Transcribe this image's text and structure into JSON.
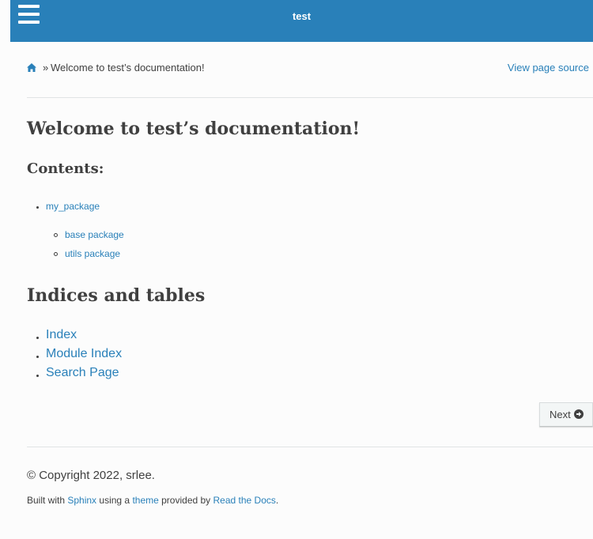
{
  "header": {
    "title": "test",
    "menu_icon": "hamburger-menu-icon",
    "color": "#2980b9"
  },
  "breadcrumbs": {
    "home_icon": "home-icon",
    "separator": "»",
    "current": "Welcome to test’s documentation!",
    "view_source": "View page source"
  },
  "main": {
    "title": "Welcome to test’s documentation!",
    "contents_caption": "Contents:",
    "toc": [
      {
        "label": "my_package",
        "children": [
          {
            "label": "base package"
          },
          {
            "label": "utils package"
          }
        ]
      }
    ],
    "indices_title": "Indices and tables",
    "indices": [
      {
        "label": "Index"
      },
      {
        "label": "Module Index"
      },
      {
        "label": "Search Page"
      }
    ]
  },
  "nav": {
    "next_label": "Next",
    "next_icon": "arrow-circle-right-icon"
  },
  "footer": {
    "copyright": "© Copyright 2022, srlee.",
    "built_prefix": "Built with ",
    "sphinx": "Sphinx",
    "using_a": " using a ",
    "theme": "theme",
    "provided_by": " provided by ",
    "rtd": "Read the Docs",
    "period": "."
  },
  "colors": {
    "link": "#2980b9",
    "text": "#404040",
    "background": "#fcfcfc"
  }
}
